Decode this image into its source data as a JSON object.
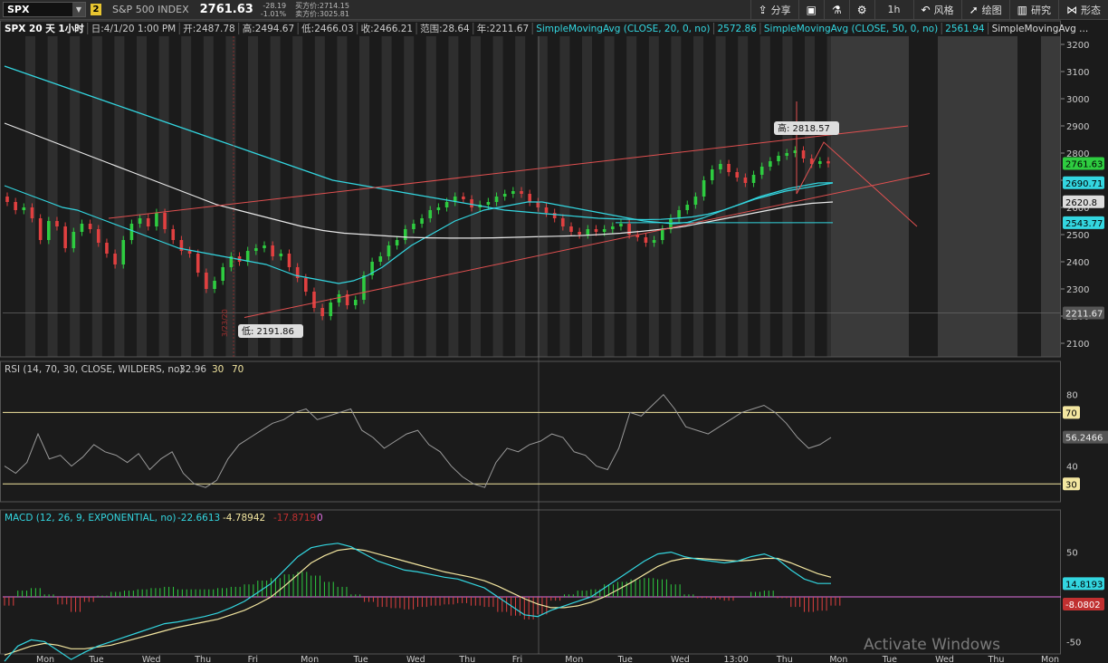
{
  "toolbar": {
    "symbol": "SPX",
    "link_badge": "2",
    "description": "S&P 500 INDEX",
    "last": "2761.63",
    "change": "-28.19",
    "change_pct": "-1.01%",
    "bid": "买方价:2714.15",
    "ask": "卖方价:3025.81",
    "share": "分享",
    "timeframe": "1h",
    "style": "风格",
    "draw": "绘图",
    "study": "研究",
    "pattern": "形态"
  },
  "header": {
    "title": "SPX 20 天 1小时",
    "date": "日:4/1/20 1:00 PM",
    "open": "开:2487.78",
    "high": "高:2494.67",
    "low": "低:2466.03",
    "close": "收:2466.21",
    "range": "范围:28.64",
    "year": "年:2211.67",
    "sma20_label": "SimpleMovingAvg (CLOSE, 20, 0, no)",
    "sma20_value": "2572.86",
    "sma50_label": "SimpleMovingAvg (CLOSE, 50, 0, no)",
    "sma50_value": "2561.94",
    "sma3_label": "SimpleMovingAvg ..."
  },
  "price_axis": {
    "ticks": [
      "3200",
      "3100",
      "3000",
      "2900",
      "2800",
      "2700",
      "2600",
      "2500",
      "2400",
      "2300",
      "2200",
      "2100"
    ],
    "badges": [
      {
        "text": "2761.63",
        "color": "#2ecc40",
        "value": 2761.63
      },
      {
        "text": "2690.71",
        "color": "#33d6e0",
        "value": 2690.71
      },
      {
        "text": "2620.8",
        "color": "#dddddd",
        "value": 2620.8
      },
      {
        "text": "2543.77",
        "color": "#33d6e0",
        "value": 2543.77
      },
      {
        "text": "2211.67",
        "color": "#555555",
        "value": 2211.67
      }
    ],
    "high_label": "高: 2818.57",
    "low_label": "低: 2191.86",
    "date_marker": "3/23/20"
  },
  "rsi": {
    "label": "RSI (14, 70, 30, CLOSE, WILDERS, no)",
    "value": "32.96",
    "ob": "30",
    "os": "70",
    "ticks": [
      "80",
      "40"
    ],
    "badge_70": "70",
    "badge_30": "30",
    "badge_value": "56.2466"
  },
  "macd": {
    "label": "MACD (12, 26, 9, EXPONENTIAL, no)",
    "value": "-22.6613",
    "avg": "-4.78942",
    "diff": "-17.8719",
    "zero": "0",
    "ticks": [
      "50",
      "-50"
    ],
    "badge_value": "14.8193",
    "badge_avg": "-8.0802"
  },
  "time_axis": [
    "Mon",
    "Tue",
    "Wed",
    "Thu",
    "Fri",
    "Mon",
    "Tue",
    "Wed",
    "Thu",
    "Fri",
    "Mon",
    "Tue",
    "Wed",
    "13:00",
    "Thu",
    "Mon",
    "Tue",
    "Wed",
    "Thu",
    "Mon"
  ],
  "watermark": "Activate Windows",
  "colors": {
    "up": "#2ecc40",
    "down": "#e04040",
    "sma20": "#33d6e0",
    "sma50": "#33d6e0",
    "sma200": "#e8e8e8",
    "trend": "#e05050",
    "macd": "#33d6e0",
    "signal": "#f3e6a0",
    "rsi": "#9a9a9a"
  },
  "chart_data": {
    "type": "candlestick",
    "y_range": [
      2050,
      3230
    ],
    "closes": [
      2620,
      2590,
      2600,
      2560,
      2480,
      2550,
      2530,
      2450,
      2510,
      2540,
      2520,
      2470,
      2430,
      2390,
      2480,
      2540,
      2560,
      2530,
      2580,
      2520,
      2480,
      2440,
      2430,
      2360,
      2300,
      2330,
      2380,
      2420,
      2400,
      2440,
      2450,
      2460,
      2420,
      2430,
      2380,
      2340,
      2290,
      2230,
      2200,
      2250,
      2280,
      2240,
      2260,
      2350,
      2400,
      2420,
      2460,
      2480,
      2520,
      2540,
      2560,
      2590,
      2600,
      2620,
      2640,
      2630,
      2600,
      2610,
      2620,
      2640,
      2650,
      2660,
      2650,
      2620,
      2600,
      2580,
      2560,
      2530,
      2510,
      2500,
      2520,
      2510,
      2520,
      2530,
      2540,
      2500,
      2490,
      2470,
      2480,
      2520,
      2560,
      2590,
      2610,
      2640,
      2700,
      2740,
      2760,
      2730,
      2710,
      2690,
      2720,
      2750,
      2770,
      2790,
      2800,
      2810,
      2780,
      2760,
      2770,
      2762
    ],
    "sma20": [
      2680,
      2660,
      2640,
      2620,
      2600,
      2590,
      2570,
      2550,
      2530,
      2510,
      2490,
      2470,
      2450,
      2440,
      2430,
      2420,
      2410,
      2400,
      2390,
      2370,
      2350,
      2340,
      2330,
      2320,
      2330,
      2350,
      2380,
      2420,
      2460,
      2490,
      2520,
      2550,
      2570,
      2590,
      2600,
      2610,
      2620,
      2620,
      2610,
      2600,
      2590,
      2580,
      2570,
      2560,
      2550,
      2545,
      2540,
      2545,
      2560,
      2580,
      2600,
      2620,
      2640,
      2655,
      2670,
      2680,
      2690,
      2691
    ],
    "sma50": [
      3120,
      3100,
      3080,
      3060,
      3040,
      3020,
      3000,
      2980,
      2960,
      2940,
      2920,
      2900,
      2880,
      2860,
      2840,
      2820,
      2800,
      2780,
      2760,
      2740,
      2720,
      2700,
      2690,
      2680,
      2670,
      2660,
      2650,
      2640,
      2630,
      2620,
      2610,
      2600,
      2590,
      2585,
      2580,
      2575,
      2570,
      2565,
      2560,
      2558,
      2556,
      2555,
      2556,
      2560,
      2565,
      2575,
      2590,
      2610,
      2630,
      2645,
      2660,
      2670,
      2680,
      2690
    ],
    "sma200": [
      2910,
      2880,
      2850,
      2820,
      2790,
      2760,
      2730,
      2700,
      2670,
      2640,
      2610,
      2590,
      2570,
      2550,
      2530,
      2515,
      2505,
      2500,
      2495,
      2490,
      2488,
      2487,
      2487,
      2488,
      2490,
      2492,
      2494,
      2496,
      2500,
      2505,
      2512,
      2520,
      2530,
      2545,
      2560,
      2575,
      2590,
      2605,
      2615,
      2620
    ],
    "rsi": [
      40,
      36,
      42,
      58,
      44,
      46,
      40,
      45,
      52,
      48,
      46,
      42,
      47,
      38,
      44,
      48,
      36,
      30,
      28,
      32,
      44,
      52,
      56,
      60,
      64,
      66,
      70,
      72,
      66,
      68,
      70,
      72,
      60,
      56,
      50,
      54,
      58,
      60,
      52,
      48,
      40,
      34,
      30,
      28,
      42,
      50,
      48,
      52,
      54,
      58,
      56,
      48,
      46,
      40,
      38,
      50,
      70,
      68,
      74,
      80,
      72,
      62,
      60,
      58,
      62,
      66,
      70,
      72,
      74,
      70,
      64,
      56,
      50,
      52,
      56
    ],
    "macd": [
      -72,
      -55,
      -48,
      -50,
      -60,
      -70,
      -62,
      -55,
      -50,
      -45,
      -40,
      -35,
      -30,
      -28,
      -25,
      -22,
      -18,
      -12,
      -5,
      5,
      15,
      30,
      45,
      55,
      58,
      60,
      56,
      48,
      40,
      35,
      30,
      28,
      25,
      22,
      20,
      15,
      10,
      0,
      -10,
      -20,
      -22,
      -15,
      -10,
      -5,
      0,
      10,
      20,
      30,
      40,
      48,
      50,
      45,
      42,
      40,
      38,
      40,
      45,
      48,
      42,
      30,
      20,
      15,
      15
    ],
    "signal": [
      -65,
      -60,
      -55,
      -52,
      -54,
      -58,
      -58,
      -56,
      -54,
      -50,
      -46,
      -42,
      -38,
      -34,
      -31,
      -28,
      -25,
      -20,
      -15,
      -8,
      0,
      12,
      25,
      38,
      46,
      52,
      54,
      52,
      48,
      44,
      40,
      36,
      32,
      28,
      25,
      22,
      18,
      12,
      5,
      -2,
      -8,
      -12,
      -12,
      -10,
      -6,
      0,
      8,
      16,
      25,
      34,
      40,
      43,
      43,
      42,
      41,
      40,
      41,
      43,
      43,
      38,
      32,
      26,
      22
    ]
  }
}
